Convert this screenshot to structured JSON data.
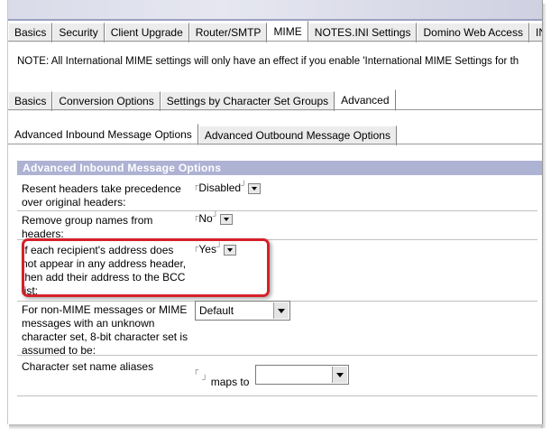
{
  "top_tabs": [
    "Basics",
    "Security",
    "Client Upgrade",
    "Router/SMTP",
    "MIME",
    "NOTES.INI Settings",
    "Domino Web Access",
    "IN"
  ],
  "note": "NOTE: All International MIME settings will only have an effect if you enable 'International MIME Settings for th",
  "mime_tabs": [
    "Basics",
    "Conversion Options",
    "Settings by Character Set Groups",
    "Advanced"
  ],
  "advanced_tabs": [
    "Advanced Inbound Message Options",
    "Advanced Outbound Message Options"
  ],
  "section_title": "Advanced Inbound Message Options",
  "rows": [
    {
      "label": "Resent headers take precedence over original headers:",
      "value": "Disabled"
    },
    {
      "label": "Remove group names from headers:",
      "value": "No"
    },
    {
      "label": "If each recipient's address does not appear in any  address header, then add their address to the BCC list:",
      "value": "Yes"
    },
    {
      "label": "For non-MIME messages or MIME messages with an unknown character set, 8-bit character set is assumed to be:",
      "value": "Default"
    },
    {
      "label": "Character set name aliases",
      "value": "",
      "maps_to": "maps to"
    }
  ],
  "colors": {
    "section_header": "#aeb2d3",
    "highlight": "#d6202a"
  }
}
